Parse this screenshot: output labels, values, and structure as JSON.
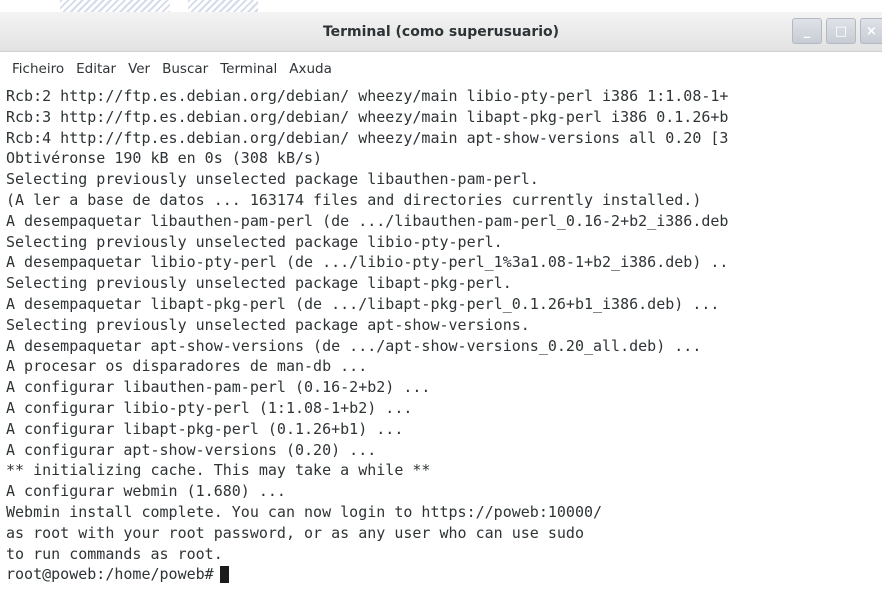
{
  "window": {
    "title": "Terminal (como superusuario)",
    "controls": {
      "minimize": "_",
      "maximize": "□",
      "close": "×"
    }
  },
  "menu": [
    "Ficheiro",
    "Editar",
    "Ver",
    "Buscar",
    "Terminal",
    "Axuda"
  ],
  "terminal": {
    "lines": [
      "Rcb:2 http://ftp.es.debian.org/debian/ wheezy/main libio-pty-perl i386 1:1.08-1+",
      "Rcb:3 http://ftp.es.debian.org/debian/ wheezy/main libapt-pkg-perl i386 0.1.26+b",
      "Rcb:4 http://ftp.es.debian.org/debian/ wheezy/main apt-show-versions all 0.20 [3",
      "Obtivéronse 190 kB en 0s (308 kB/s)",
      "Selecting previously unselected package libauthen-pam-perl.",
      "(A ler a base de datos ... 163174 files and directories currently installed.)",
      "A desempaquetar libauthen-pam-perl (de .../libauthen-pam-perl_0.16-2+b2_i386.deb",
      "Selecting previously unselected package libio-pty-perl.",
      "A desempaquetar libio-pty-perl (de .../libio-pty-perl_1%3a1.08-1+b2_i386.deb) ..",
      "Selecting previously unselected package libapt-pkg-perl.",
      "A desempaquetar libapt-pkg-perl (de .../libapt-pkg-perl_0.1.26+b1_i386.deb) ...",
      "Selecting previously unselected package apt-show-versions.",
      "A desempaquetar apt-show-versions (de .../apt-show-versions_0.20_all.deb) ...",
      "A procesar os disparadores de man-db ...",
      "A configurar libauthen-pam-perl (0.16-2+b2) ...",
      "A configurar libio-pty-perl (1:1.08-1+b2) ...",
      "A configurar libapt-pkg-perl (0.1.26+b1) ...",
      "A configurar apt-show-versions (0.20) ...",
      "** initializing cache. This may take a while **",
      "A configurar webmin (1.680) ...",
      "Webmin install complete. You can now login to https://poweb:10000/",
      "as root with your root password, or as any user who can use sudo",
      "to run commands as root."
    ],
    "prompt": "root@poweb:/home/poweb#"
  }
}
